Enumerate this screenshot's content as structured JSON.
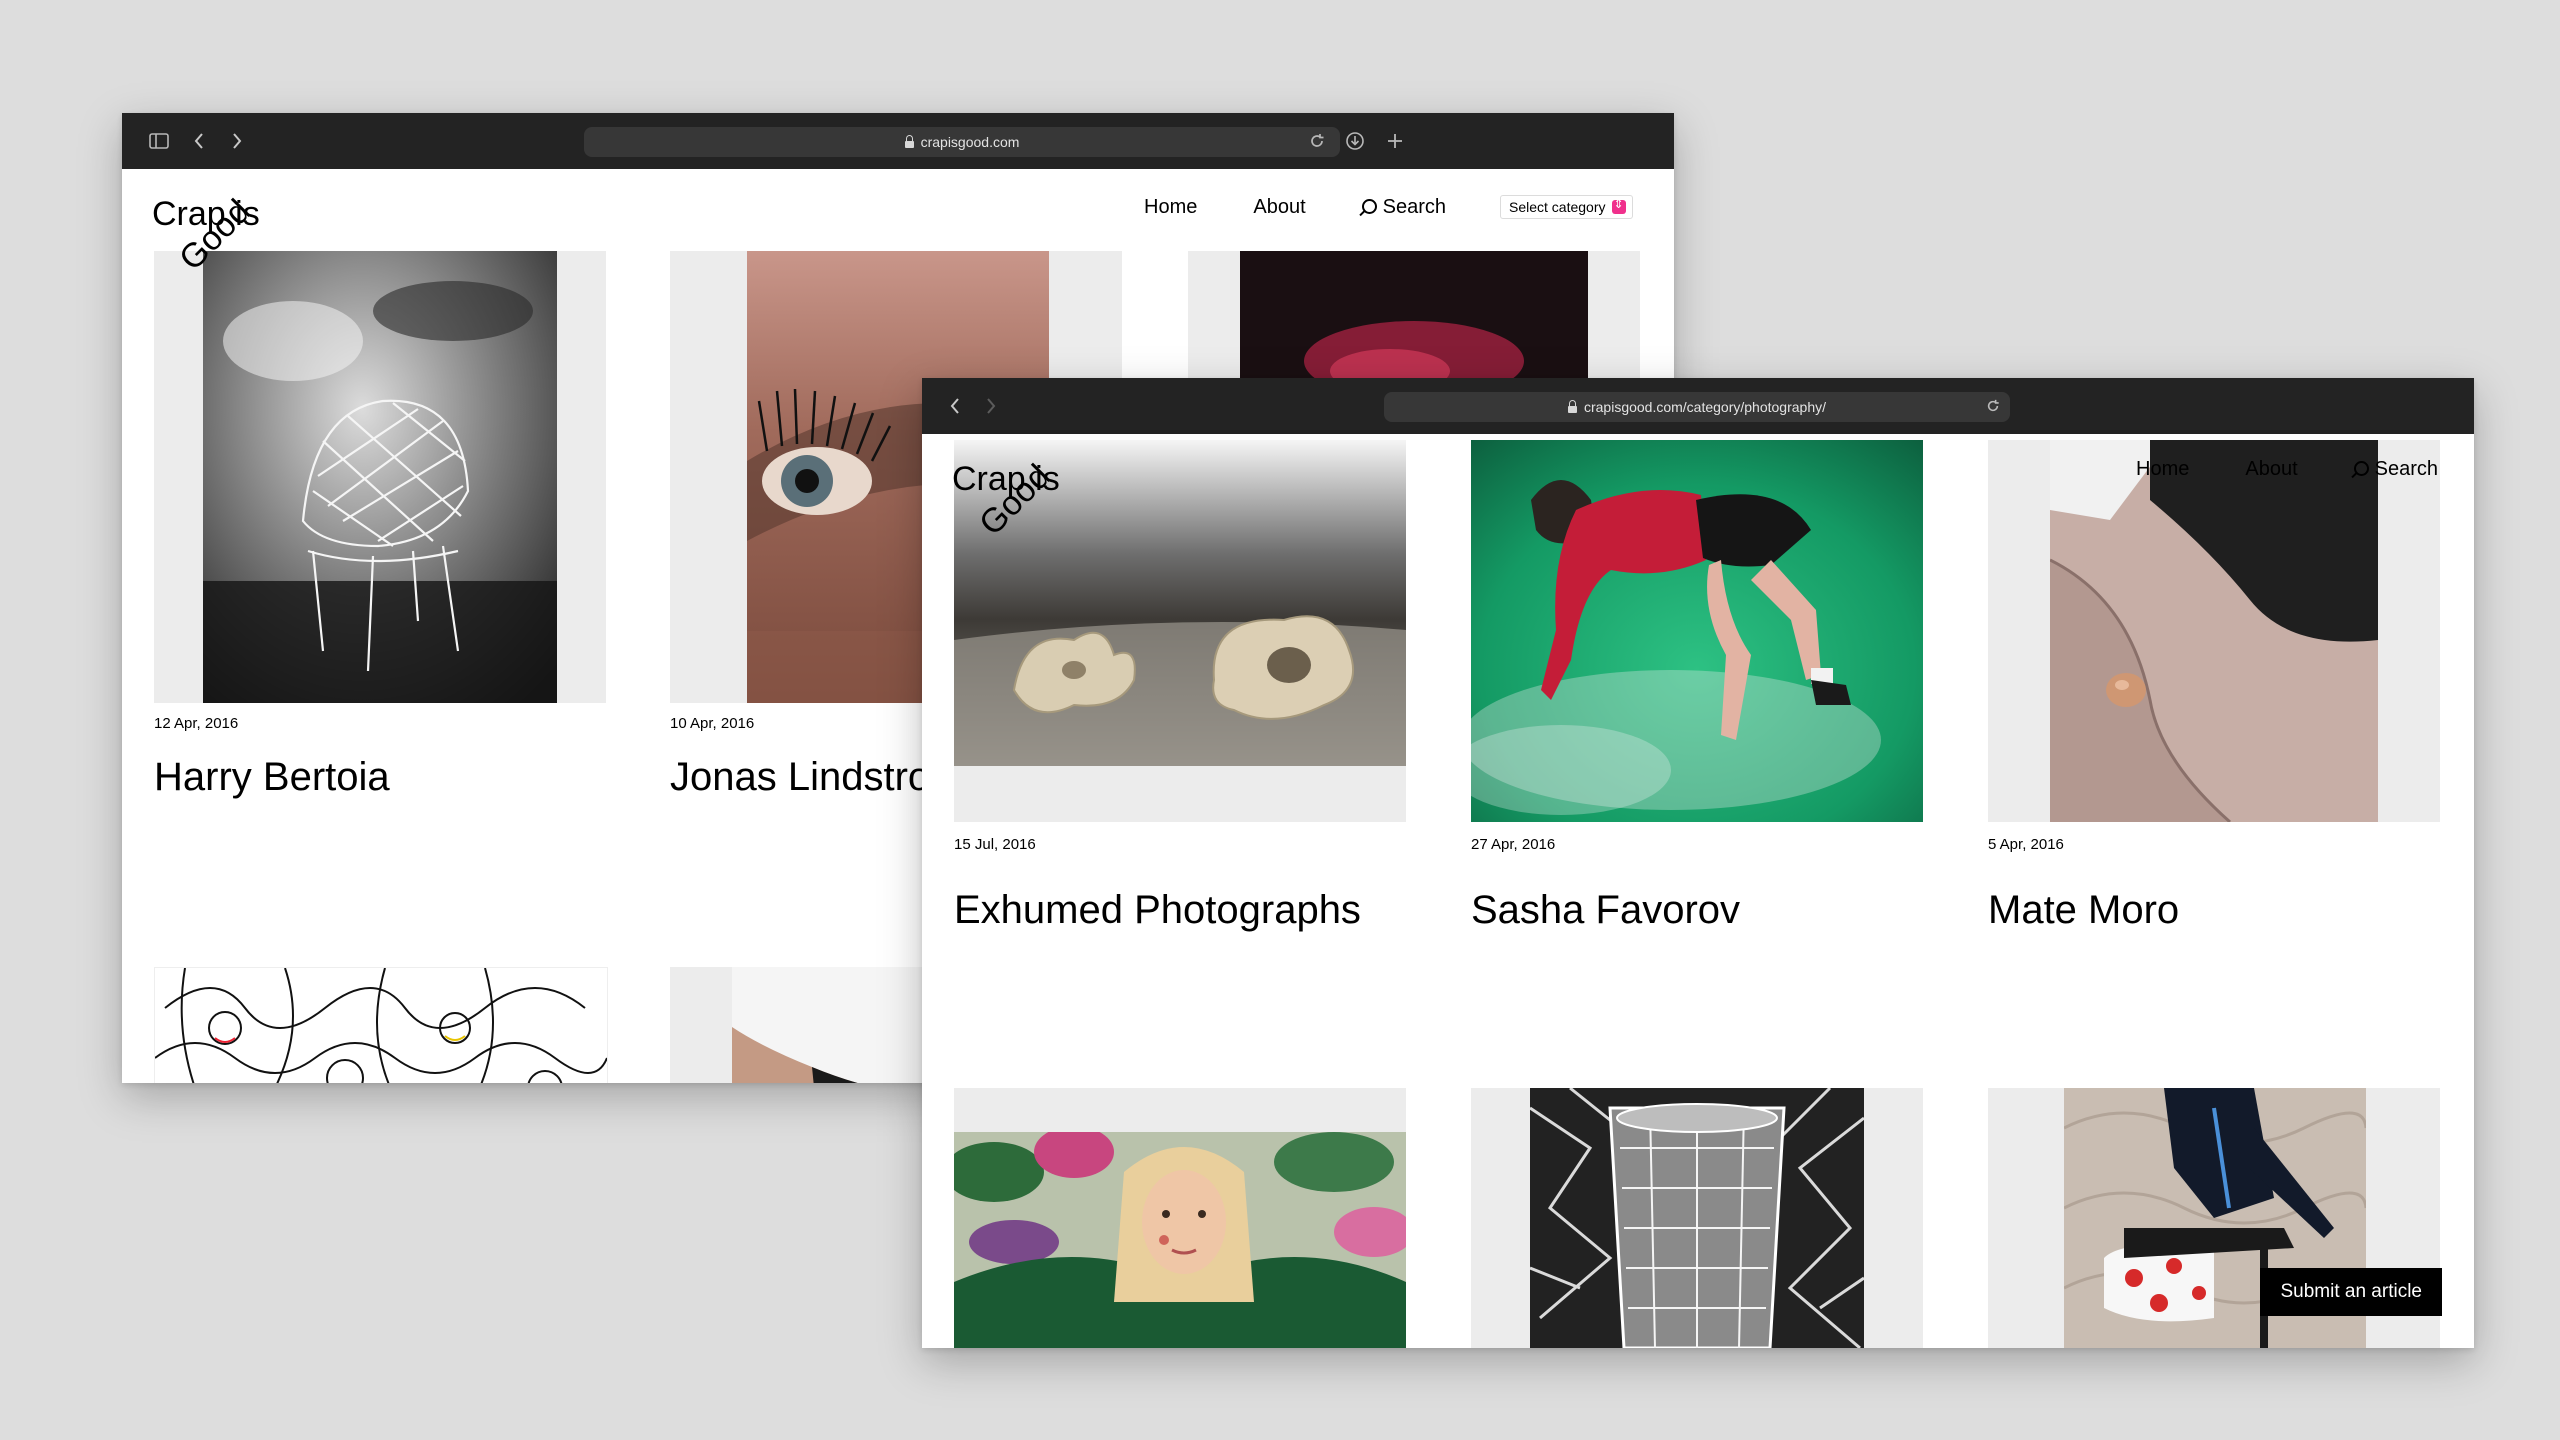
{
  "window_back": {
    "url": "crapisgood.com",
    "logo": {
      "line1": "Crap is",
      "line2": "Good"
    },
    "nav": {
      "home": "Home",
      "about": "About",
      "search": "Search",
      "category_select": "Select category"
    },
    "posts": [
      {
        "date": "12 Apr, 2016",
        "title": "Harry Bertoia"
      },
      {
        "date": "10 Apr, 2016",
        "title": "Jonas Lindstro"
      }
    ]
  },
  "window_front": {
    "url": "crapisgood.com/category/photography/",
    "logo": {
      "line1": "Crap is",
      "line2": "Good"
    },
    "nav": {
      "home": "Home",
      "about": "About",
      "search": "Search"
    },
    "posts": [
      {
        "date": "15 Jul, 2016",
        "title": "Exhumed Photographs"
      },
      {
        "date": "27 Apr, 2016",
        "title": "Sasha Favorov"
      },
      {
        "date": "5 Apr, 2016",
        "title": "Mate Moro"
      }
    ],
    "submit_button": "Submit an article"
  },
  "colors": {
    "toolbar": "#232323",
    "accent": "#f0308c",
    "page_bg": "#dddddd"
  },
  "icons": [
    "sidebar-icon",
    "back-icon",
    "forward-icon",
    "lock-icon",
    "reload-icon",
    "download-icon",
    "new-tab-icon",
    "search-icon",
    "select-arrows-icon"
  ]
}
